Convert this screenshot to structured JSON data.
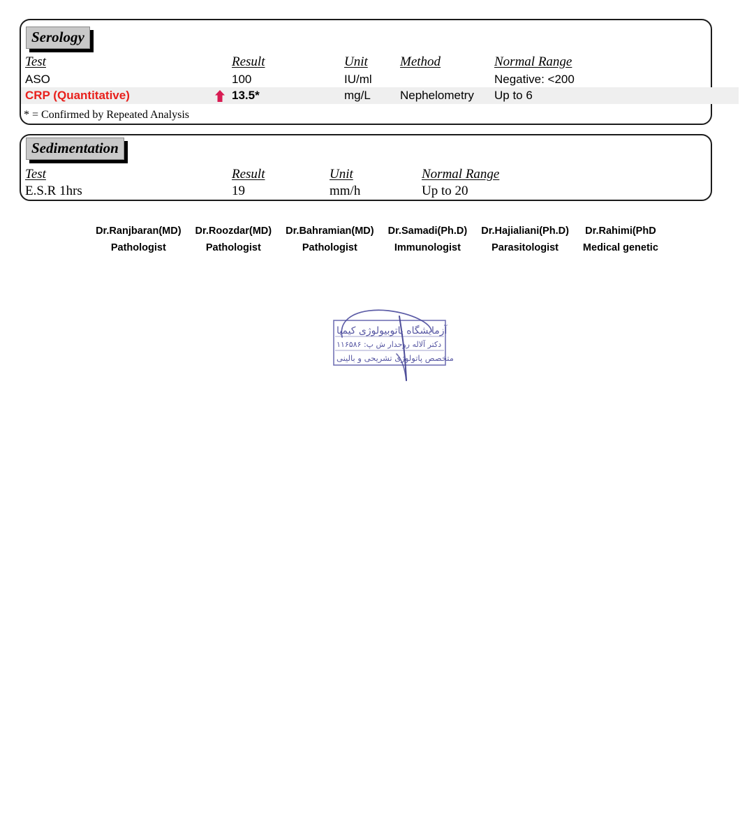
{
  "report": {
    "sections": [
      {
        "id": "serology",
        "title": "Serology",
        "columns": [
          "Test",
          "Result",
          "Unit",
          "Method",
          "Normal Range"
        ],
        "rows": [
          {
            "test": "ASO",
            "result": "100",
            "unit": "IU/ml",
            "method": "",
            "normal_range": "Negative: <200",
            "abnormal": false,
            "flag": ""
          },
          {
            "test": "CRP (Quantitative)",
            "result": "13.5*",
            "unit": "mg/L",
            "method": "Nephelometry",
            "normal_range": "Up to 6",
            "abnormal": true,
            "flag": "up-arrow-icon"
          }
        ],
        "footnote": "* = Confirmed by Repeated Analysis"
      },
      {
        "id": "sedimentation",
        "title": "Sedimentation",
        "columns": [
          "Test",
          "Result",
          "Unit",
          "Normal Range"
        ],
        "rows": [
          {
            "test": "E.S.R 1hrs",
            "result": "19",
            "unit": "mm/h",
            "normal_range": "Up to 20",
            "abnormal": false,
            "flag": ""
          }
        ],
        "footnote": ""
      }
    ]
  },
  "signatories": [
    {
      "name": "Dr.Ranjbaran(MD)",
      "role": "Pathologist"
    },
    {
      "name": "Dr.Roozdar(MD)",
      "role": "Pathologist"
    },
    {
      "name": "Dr.Bahramian(MD)",
      "role": "Pathologist"
    },
    {
      "name": "Dr.Samadi(Ph.D)",
      "role": "Immunologist"
    },
    {
      "name": "Dr.Hajialiani(Ph.D)",
      "role": "Parasitologist"
    },
    {
      "name": "Dr.Rahimi(PhD",
      "role": "Medical genetic"
    }
  ],
  "stamp": {
    "name": "laboratory-stamp",
    "line1": "آزمایشگاه پاتوبیولوژی کیمیا",
    "line2": "دکتر آلاله روحدار ش پ: ۱۱۶۵۸۶",
    "line3": "متخصص پاتولوژی تشریحی و بالینی",
    "ink_color": "#4a4a9c"
  },
  "colors": {
    "abnormal_text": "#e8201c",
    "flag_arrow": "#d81b52",
    "row_highlight": "#efefef",
    "badge_background": "#c9c9c9",
    "border": "#1b1b1b"
  }
}
